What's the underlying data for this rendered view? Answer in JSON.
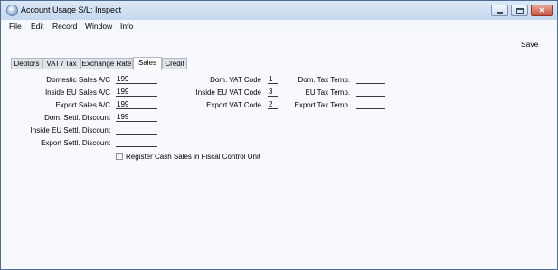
{
  "window": {
    "title": "Account Usage S/L: Inspect",
    "minimize_glyph": "",
    "close_glyph": "✕"
  },
  "menu": [
    "File",
    "Edit",
    "Record",
    "Window",
    "Info"
  ],
  "toolbar": {
    "save_label": "Save"
  },
  "tabs": [
    {
      "label": "Debtors",
      "active": false
    },
    {
      "label": "VAT / Tax",
      "active": false
    },
    {
      "label": "Exchange Rate",
      "active": false
    },
    {
      "label": "Sales",
      "active": true
    },
    {
      "label": "Credit",
      "active": false
    }
  ],
  "sales": {
    "left": [
      {
        "label": "Domestic Sales A/C",
        "value": "199"
      },
      {
        "label": "Inside EU Sales A/C",
        "value": "199"
      },
      {
        "label": "Export Sales A/C",
        "value": "199"
      },
      {
        "label": "Dom. Settl. Discount",
        "value": "199"
      },
      {
        "label": "Inside EU  Settl. Discount",
        "value": ""
      },
      {
        "label": "Export Settl. Discount",
        "value": ""
      }
    ],
    "middle": [
      {
        "label": "Dom. VAT Code",
        "value": "1"
      },
      {
        "label": "Inside EU VAT Code",
        "value": "3"
      },
      {
        "label": "Export VAT Code",
        "value": "2"
      }
    ],
    "right": [
      {
        "label": "Dom. Tax Temp.",
        "value": ""
      },
      {
        "label": "EU Tax Temp.",
        "value": ""
      },
      {
        "label": "Export Tax Temp.",
        "value": ""
      }
    ],
    "register_cash_label": "Register Cash Sales in Fiscal Control Unit",
    "register_cash_checked": false
  }
}
